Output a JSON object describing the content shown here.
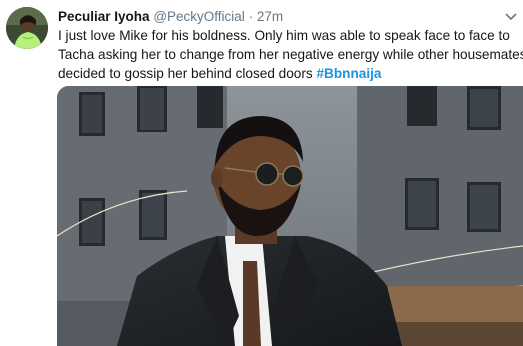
{
  "tweet": {
    "author_name": "Peculiar Iyoha",
    "handle": "@PeckyOfficial",
    "separator": "·",
    "time": "27m",
    "text_lines": [
      "I just love Mike for his boldness. Only him was able to speak face to face to",
      "Tacha asking her to change from her negative energy while other housemates",
      "decided to gossip her behind closed doors"
    ],
    "hashtag": "#Bbnnaija"
  },
  "colors": {
    "name": "#14171a",
    "meta": "#657786",
    "hashtag": "#1b95e0"
  },
  "icons": {
    "menu": "chevron-down-icon"
  }
}
